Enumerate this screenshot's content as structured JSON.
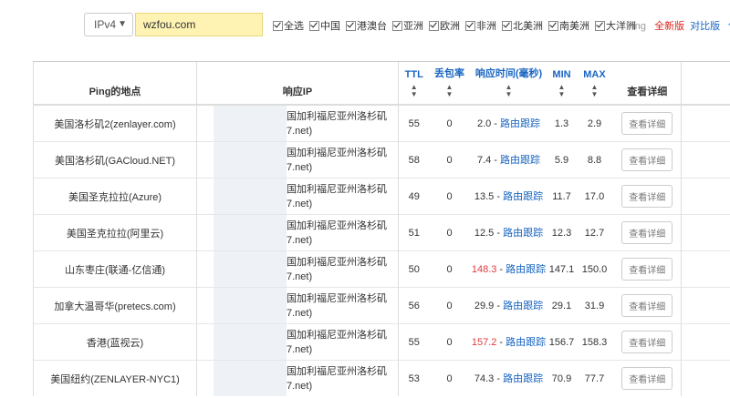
{
  "toolbar": {
    "ip_version": "IPv4",
    "domain": "wzfou.com",
    "regions": [
      "全选",
      "中国",
      "港澳台",
      "亚洲",
      "欧洲",
      "非洲",
      "北美洲",
      "南美洲",
      "大洋洲"
    ],
    "ping_label": "Ping",
    "new_version": "全新版",
    "compare_version": "对比版",
    "use_label": "使"
  },
  "table": {
    "headers": {
      "location": "Ping的地点",
      "ip": "响应IP",
      "ttl": "TTL",
      "loss": "丢包率",
      "resp": "响应时间(毫秒)",
      "min": "MIN",
      "max": "MAX",
      "detail": "查看详细"
    },
    "route_label": "路由跟踪",
    "detail_button": "查看详细",
    "rows": [
      {
        "loc": "美国洛杉矶2(zenlayer.com)",
        "ip1": "国加利福尼亚州洛杉矶",
        "ip2": "7.net)",
        "ttl": "55",
        "loss": "0",
        "resp": "2.0",
        "min": "1.3",
        "max": "2.9",
        "slow": false
      },
      {
        "loc": "美国洛杉矶(GACloud.NET)",
        "ip1": "国加利福尼亚州洛杉矶",
        "ip2": "7.net)",
        "ttl": "58",
        "loss": "0",
        "resp": "7.4",
        "min": "5.9",
        "max": "8.8",
        "slow": false
      },
      {
        "loc": "美国圣克拉拉(Azure)",
        "ip1": "国加利福尼亚州洛杉矶",
        "ip2": "7.net)",
        "ttl": "49",
        "loss": "0",
        "resp": "13.5",
        "min": "11.7",
        "max": "17.0",
        "slow": false
      },
      {
        "loc": "美国圣克拉拉(阿里云)",
        "ip1": "国加利福尼亚州洛杉矶",
        "ip2": "7.net)",
        "ttl": "51",
        "loss": "0",
        "resp": "12.5",
        "min": "12.3",
        "max": "12.7",
        "slow": false
      },
      {
        "loc": "山东枣庄(联通-亿信通)",
        "ip1": "国加利福尼亚州洛杉矶",
        "ip2": "7.net)",
        "ttl": "50",
        "loss": "0",
        "resp": "148.3",
        "min": "147.1",
        "max": "150.0",
        "slow": true
      },
      {
        "loc": "加拿大温哥华(pretecs.com)",
        "ip1": "国加利福尼亚州洛杉矶",
        "ip2": "7.net)",
        "ttl": "56",
        "loss": "0",
        "resp": "29.9",
        "min": "29.1",
        "max": "31.9",
        "slow": false
      },
      {
        "loc": "香港(蓝视云)",
        "ip1": "国加利福尼亚州洛杉矶",
        "ip2": "7.net)",
        "ttl": "55",
        "loss": "0",
        "resp": "157.2",
        "min": "156.7",
        "max": "158.3",
        "slow": true
      },
      {
        "loc": "美国纽约(ZENLAYER-NYC1)",
        "ip1": "国加利福尼亚州洛杉矶",
        "ip2": "7.net)",
        "ttl": "53",
        "loss": "0",
        "resp": "74.3",
        "min": "70.9",
        "max": "77.7",
        "slow": false
      }
    ]
  }
}
